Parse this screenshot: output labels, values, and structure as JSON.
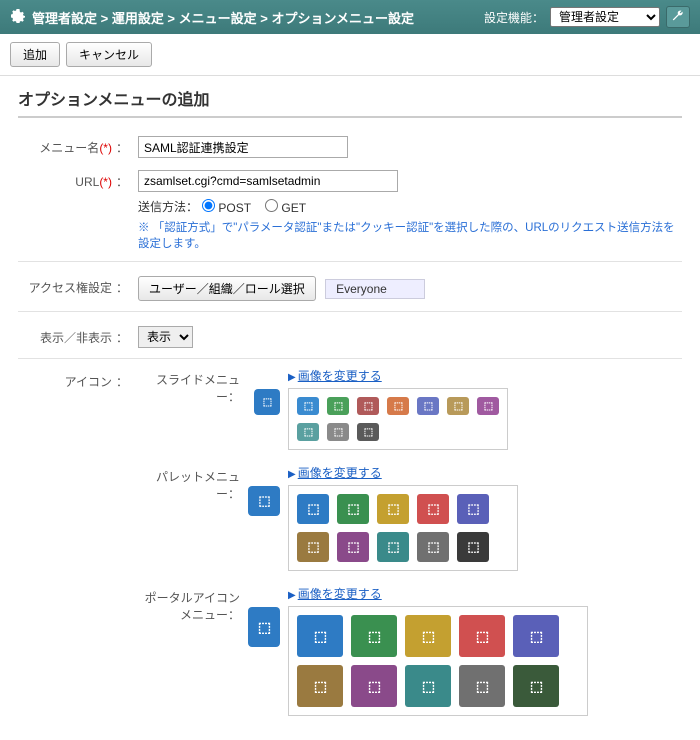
{
  "header": {
    "breadcrumb": [
      "管理者設定",
      "運用設定",
      "メニュー設定",
      "オプションメニュー設定"
    ],
    "func_label": "設定機能：",
    "func_selected": "管理者設定"
  },
  "toolbar": {
    "add": "追加",
    "cancel": "キャンセル"
  },
  "page_title": "オプションメニューの追加",
  "form": {
    "menu_name": {
      "label": "メニュー名",
      "required": "(*)",
      "value": "SAML認証連携設定"
    },
    "url": {
      "label": "URL",
      "required": "(*)",
      "value": "zsamlset.cgi?cmd=samlsetadmin",
      "method_label": "送信方法：",
      "post": "POST",
      "get": "GET",
      "method_selected": "POST",
      "hint": "※ 「認証方式」で\"パラメータ認証\"または\"クッキー認証\"を選択した際の、URLのリクエスト送信方法を設定します。"
    },
    "access": {
      "label": "アクセス権設定",
      "button": "ユーザー／組織／ロール選択",
      "value": "Everyone"
    },
    "visibility": {
      "label": "表示／非表示",
      "selected": "表示"
    },
    "icon": {
      "label": "アイコン",
      "change_link": "画像を変更する",
      "slide": {
        "label": "スライドメニュー"
      },
      "palette": {
        "label": "パレットメニュー"
      },
      "portal": {
        "label": "ポータルアイコン",
        "sub": "メニュー"
      }
    }
  },
  "colors": {
    "slide": [
      "#3a8bd0",
      "#4aa05a",
      "#b05a5a",
      "#d67a4a",
      "#6a77c4",
      "#b89a5a",
      "#a05aa0",
      "#5aa0a0",
      "#8a8a8a",
      "#5a5a5a"
    ],
    "palette": [
      "#2e7bc4",
      "#3a9050",
      "#c4a030",
      "#d05050",
      "#5a60b8",
      "#9a7a40",
      "#8a4a8a",
      "#3a8a8a",
      "#707070",
      "#3a3a3a"
    ],
    "portal": [
      "#2e7bc4",
      "#3a9050",
      "#c4a030",
      "#d05050",
      "#5a60b8",
      "#9a7a40",
      "#8a4a8a",
      "#3a8a8a",
      "#707070",
      "#3a5a3a"
    ],
    "preview": "#2e7bc4"
  }
}
